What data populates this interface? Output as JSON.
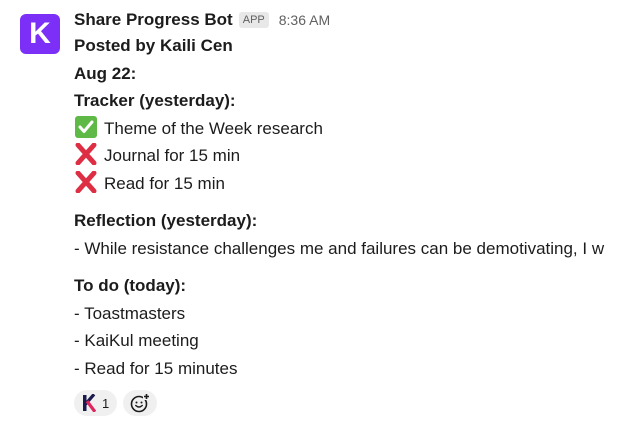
{
  "message": {
    "avatar_letter": "K",
    "bot_name": "Share Progress Bot",
    "app_badge": "APP",
    "time": "8:36 AM",
    "posted_by": "Posted by Kaili Cen",
    "date": "Aug 22:",
    "tracker_heading": "Tracker (yesterday):",
    "tracker_items": [
      {
        "status": "check",
        "text": "Theme of the Week research"
      },
      {
        "status": "cross",
        "text": "Journal for 15 min"
      },
      {
        "status": "cross",
        "text": "Read for 15 min"
      }
    ],
    "reflection_heading": "Reflection (yesterday):",
    "reflection_text": "- While resistance challenges me and failures can be demotivating, I w",
    "todo_heading": "To do (today):",
    "todo_items": [
      "- Toastmasters",
      "- KaiKul meeting",
      "- Read for 15 minutes"
    ]
  },
  "reactions": {
    "kaikul_emoji": "K",
    "kaikul_count": "1"
  },
  "colors": {
    "avatar": "#7b2ff7",
    "check": "#5fb946",
    "cross": "#dd2e44",
    "k_logo_dark": "#1a1a4e",
    "k_logo_red": "#e0245e"
  }
}
